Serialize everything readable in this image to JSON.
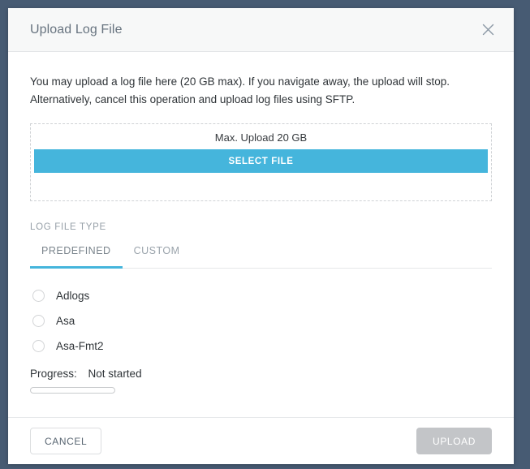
{
  "window": {
    "backdrop_color": "#475b73"
  },
  "header": {
    "title": "Upload Log File",
    "close_icon": "close-icon"
  },
  "body": {
    "intro_line_1": "You may upload a log file here (20 GB max). If you navigate away, the upload will stop.",
    "intro_line_2": "Alternatively, cancel this operation and upload log files using SFTP.",
    "dropzone": {
      "max_upload_label": "Max. Upload 20 GB",
      "select_file_label": "SELECT FILE",
      "accent_color": "#45b5dc"
    },
    "log_file_type": {
      "section_label": "LOG FILE TYPE",
      "tabs": [
        {
          "label": "PREDEFINED",
          "active": true
        },
        {
          "label": "CUSTOM",
          "active": false
        }
      ],
      "options": [
        {
          "label": "Adlogs",
          "selected": false
        },
        {
          "label": "Asa",
          "selected": false
        },
        {
          "label": "Asa-Fmt2",
          "selected": false
        }
      ]
    },
    "progress": {
      "label": "Progress:",
      "status": "Not started",
      "percent": 0
    }
  },
  "footer": {
    "cancel_label": "CANCEL",
    "upload_label": "UPLOAD",
    "upload_disabled": true,
    "upload_disabled_color": "#c3c5c8"
  }
}
